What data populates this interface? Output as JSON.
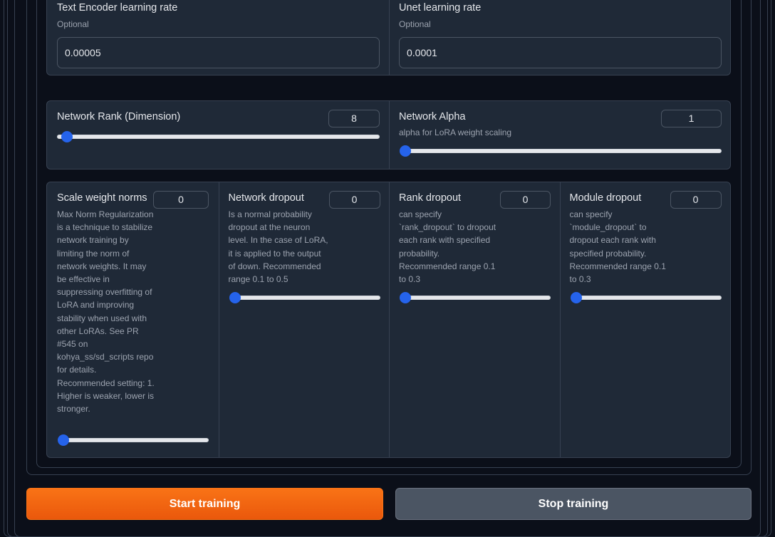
{
  "learning_rates": {
    "text_encoder": {
      "label": "Text Encoder learning rate",
      "info": "Optional",
      "value": "0.00005"
    },
    "unet": {
      "label": "Unet learning rate",
      "info": "Optional",
      "value": "0.0001"
    }
  },
  "network": {
    "rank": {
      "label": "Network Rank (Dimension)",
      "value": "8",
      "slider_fraction": 0.02
    },
    "alpha": {
      "label": "Network Alpha",
      "info": "alpha for LoRA weight scaling",
      "value": "1",
      "slider_fraction": 0.0
    }
  },
  "dropout": {
    "scale_weight_norms": {
      "label": "Scale weight norms",
      "value": "0",
      "info": "Max Norm Regularization is a technique to stabilize network training by limiting the norm of network weights. It may be effective in suppressing overfitting of LoRA and improving stability when used with other LoRAs. See PR #545 on kohya_ss/sd_scripts repo for details. Recommended setting: 1. Higher is weaker, lower is stronger.",
      "slider_fraction": 0.0
    },
    "network_dropout": {
      "label": "Network dropout",
      "value": "0",
      "info": "Is a normal probability dropout at the neuron level. In the case of LoRA, it is applied to the output of down. Recommended range 0.1 to 0.5",
      "slider_fraction": 0.0
    },
    "rank_dropout": {
      "label": "Rank dropout",
      "value": "0",
      "info": "can specify `rank_dropout` to dropout each rank with specified probability. Recommended range 0.1 to 0.3",
      "slider_fraction": 0.0
    },
    "module_dropout": {
      "label": "Module dropout",
      "value": "0",
      "info": "can specify `module_dropout` to dropout each rank with specified probability. Recommended range 0.1 to 0.3",
      "slider_fraction": 0.0
    }
  },
  "actions": {
    "start_label": "Start training",
    "stop_label": "Stop training"
  },
  "colors": {
    "background": "#0b0f19",
    "panel": "#1f2937",
    "accent": "#2563eb",
    "primary_button": "#f97316",
    "secondary_button": "#4b5563"
  }
}
